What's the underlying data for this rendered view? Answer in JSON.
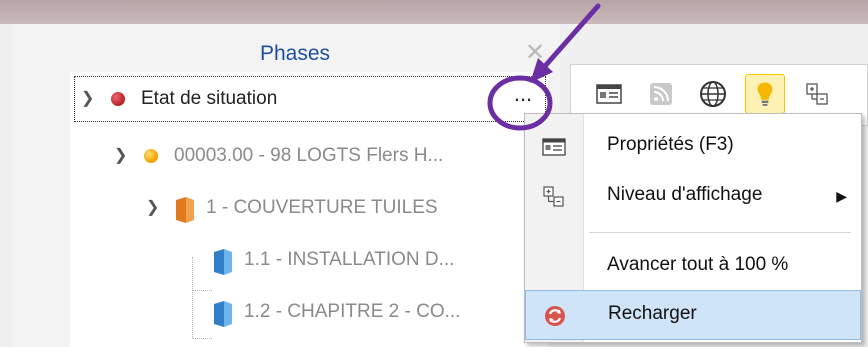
{
  "panel": {
    "title": "Phases",
    "close_glyph": "✕"
  },
  "tree": {
    "items": [
      {
        "label": "Etat de situation",
        "status_color": "#c0282d",
        "icon": "status-dot-icon"
      },
      {
        "label": "00003.00 - 98 LOGTS Flers H...",
        "status_color": "#f7a600",
        "icon": "status-dot-icon"
      },
      {
        "label": "1 - COUVERTURE TUILES",
        "icon": "folder-icon",
        "icon_color": "#e07a1f"
      },
      {
        "label": "1.1 - INSTALLATION D...",
        "icon": "folder-icon",
        "icon_color": "#2f7fc8"
      },
      {
        "label": "1.2 - CHAPITRE 2 - CO...",
        "icon": "folder-icon",
        "icon_color": "#2f7fc8"
      }
    ],
    "more_label": "..."
  },
  "toolbar": {
    "buttons": [
      {
        "icon": "properties-icon",
        "active": false
      },
      {
        "icon": "rss-feed-icon",
        "active": false
      },
      {
        "icon": "globe-icon",
        "active": false
      },
      {
        "icon": "lightbulb-icon",
        "active": true
      },
      {
        "icon": "display-level-icon",
        "active": false
      }
    ]
  },
  "context_menu": {
    "items": [
      {
        "label": "Propriétés (F3)",
        "icon": "properties-icon"
      },
      {
        "label": "Niveau d'affichage",
        "icon": "display-level-icon",
        "has_submenu": true
      },
      {
        "label": "Avancer tout à 100 %",
        "icon": ""
      },
      {
        "label": "Recharger",
        "icon": "reload-icon",
        "highlighted": true
      }
    ]
  },
  "colors": {
    "accent_title": "#1f4e9c",
    "annotation_purple": "#6b2fa3",
    "menu_highlight": "#cfe4f7"
  }
}
